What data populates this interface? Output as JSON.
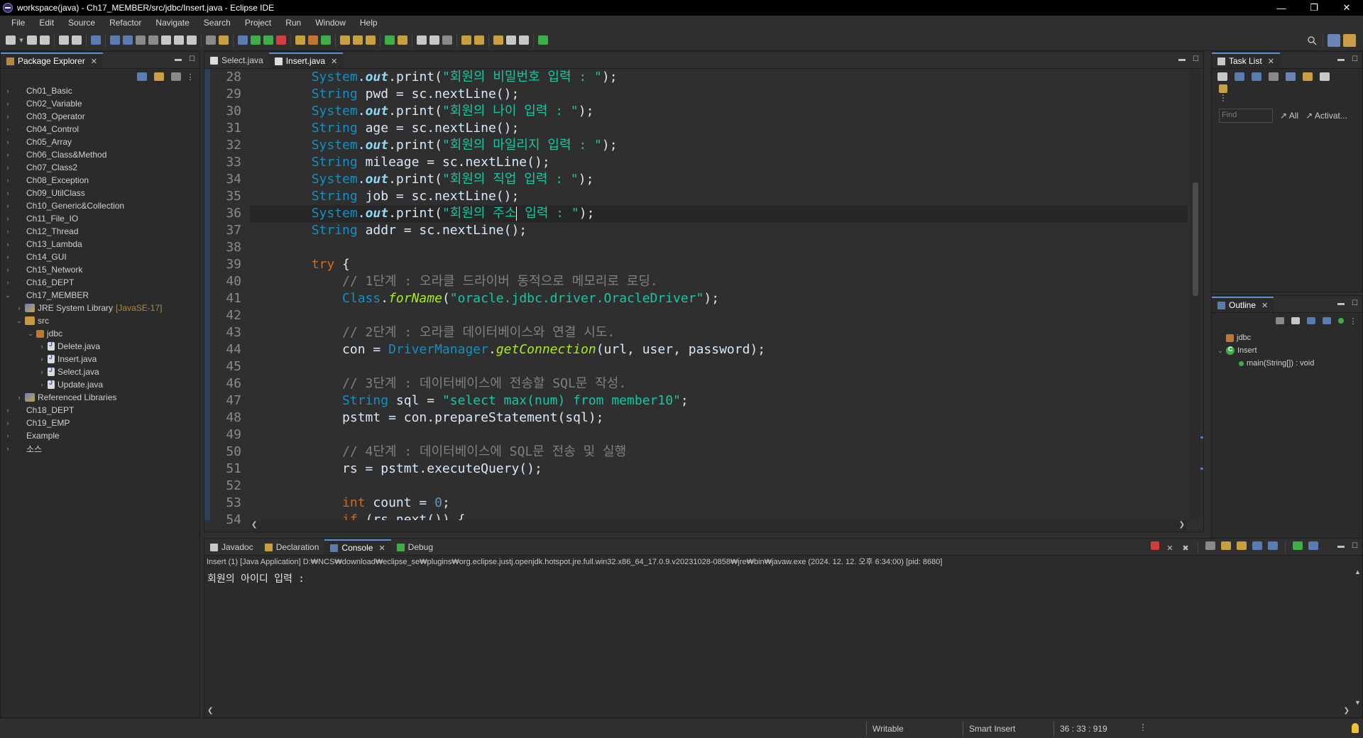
{
  "window": {
    "title": "workspace(java) - Ch17_MEMBER/src/jdbc/Insert.java - Eclipse IDE",
    "min_glyph": "—",
    "restore_glyph": "❐",
    "close_glyph": "✕"
  },
  "menu": [
    "File",
    "Edit",
    "Source",
    "Refactor",
    "Navigate",
    "Search",
    "Project",
    "Run",
    "Window",
    "Help"
  ],
  "package_explorer": {
    "tab_label": "Package Explorer",
    "items": [
      {
        "label": "Ch01_Basic",
        "indent": 0,
        "type": "project",
        "twisty": "›"
      },
      {
        "label": "Ch02_Variable",
        "indent": 0,
        "type": "project",
        "twisty": "›"
      },
      {
        "label": "Ch03_Operator",
        "indent": 0,
        "type": "project",
        "twisty": "›"
      },
      {
        "label": "Ch04_Control",
        "indent": 0,
        "type": "project",
        "twisty": "›"
      },
      {
        "label": "Ch05_Array",
        "indent": 0,
        "type": "project",
        "twisty": "›"
      },
      {
        "label": "Ch06_Class&Method",
        "indent": 0,
        "type": "project",
        "twisty": "›"
      },
      {
        "label": "Ch07_Class2",
        "indent": 0,
        "type": "project",
        "twisty": "›"
      },
      {
        "label": "Ch08_Exception",
        "indent": 0,
        "type": "project",
        "twisty": "›"
      },
      {
        "label": "Ch09_UtilClass",
        "indent": 0,
        "type": "project",
        "twisty": "›"
      },
      {
        "label": "Ch10_Generic&Collection",
        "indent": 0,
        "type": "project",
        "twisty": "›"
      },
      {
        "label": "Ch11_File_IO",
        "indent": 0,
        "type": "project",
        "twisty": "›"
      },
      {
        "label": "Ch12_Thread",
        "indent": 0,
        "type": "project",
        "twisty": "›"
      },
      {
        "label": "Ch13_Lambda",
        "indent": 0,
        "type": "project",
        "twisty": "›"
      },
      {
        "label": "Ch14_GUI",
        "indent": 0,
        "type": "project",
        "twisty": "›"
      },
      {
        "label": "Ch15_Network",
        "indent": 0,
        "type": "project",
        "twisty": "›"
      },
      {
        "label": "Ch16_DEPT",
        "indent": 0,
        "type": "project",
        "twisty": "›"
      },
      {
        "label": "Ch17_MEMBER",
        "indent": 0,
        "type": "project",
        "twisty": "⌄"
      },
      {
        "label": "JRE System Library",
        "indent": 1,
        "type": "lib",
        "twisty": "›",
        "decoration": "[JavaSE-17]"
      },
      {
        "label": "src",
        "indent": 1,
        "type": "src",
        "twisty": "⌄"
      },
      {
        "label": "jdbc",
        "indent": 2,
        "type": "pkg",
        "twisty": "⌄"
      },
      {
        "label": "Delete.java",
        "indent": 3,
        "type": "java",
        "twisty": "›"
      },
      {
        "label": "Insert.java",
        "indent": 3,
        "type": "java",
        "twisty": "›"
      },
      {
        "label": "Select.java",
        "indent": 3,
        "type": "java",
        "twisty": "›"
      },
      {
        "label": "Update.java",
        "indent": 3,
        "type": "java",
        "twisty": "›"
      },
      {
        "label": "Referenced Libraries",
        "indent": 1,
        "type": "lib",
        "twisty": "›"
      },
      {
        "label": "Ch18_DEPT",
        "indent": 0,
        "type": "project",
        "twisty": "›"
      },
      {
        "label": "Ch19_EMP",
        "indent": 0,
        "type": "project",
        "twisty": "›"
      },
      {
        "label": "Example",
        "indent": 0,
        "type": "project",
        "twisty": "›"
      },
      {
        "label": "소스",
        "indent": 0,
        "type": "project",
        "twisty": "›"
      }
    ]
  },
  "editor": {
    "tabs": [
      {
        "label": "Select.java",
        "active": false
      },
      {
        "label": "Insert.java",
        "active": true
      }
    ],
    "current_line": 36,
    "lines": [
      {
        "n": "28",
        "tokens": [
          [
            "plain",
            "        "
          ],
          [
            "cls",
            "System"
          ],
          [
            "plain",
            "."
          ],
          [
            "fld",
            "out"
          ],
          [
            "plain",
            "."
          ],
          [
            "plain",
            "print"
          ],
          [
            "plain",
            "("
          ],
          [
            "st",
            "\"회원의 비밀번호 입력 : \""
          ],
          [
            "plain",
            ");"
          ]
        ]
      },
      {
        "n": "29",
        "tokens": [
          [
            "plain",
            "        "
          ],
          [
            "cls",
            "String"
          ],
          [
            "plain",
            " pwd = sc.nextLine();"
          ]
        ]
      },
      {
        "n": "30",
        "tokens": [
          [
            "plain",
            "        "
          ],
          [
            "cls",
            "System"
          ],
          [
            "plain",
            "."
          ],
          [
            "fld",
            "out"
          ],
          [
            "plain",
            ".print("
          ],
          [
            "st",
            "\"회원의 나이 입력 : \""
          ],
          [
            "plain",
            ");"
          ]
        ]
      },
      {
        "n": "31",
        "tokens": [
          [
            "plain",
            "        "
          ],
          [
            "cls",
            "String"
          ],
          [
            "plain",
            " age = sc.nextLine();"
          ]
        ]
      },
      {
        "n": "32",
        "tokens": [
          [
            "plain",
            "        "
          ],
          [
            "cls",
            "System"
          ],
          [
            "plain",
            "."
          ],
          [
            "fld",
            "out"
          ],
          [
            "plain",
            ".print("
          ],
          [
            "st",
            "\"회원의 마일리지 입력 : \""
          ],
          [
            "plain",
            ");"
          ]
        ]
      },
      {
        "n": "33",
        "tokens": [
          [
            "plain",
            "        "
          ],
          [
            "cls",
            "String"
          ],
          [
            "plain",
            " mileage = sc.nextLine();"
          ]
        ]
      },
      {
        "n": "34",
        "tokens": [
          [
            "plain",
            "        "
          ],
          [
            "cls",
            "System"
          ],
          [
            "plain",
            "."
          ],
          [
            "fld",
            "out"
          ],
          [
            "plain",
            ".print("
          ],
          [
            "st",
            "\"회원의 직업 입력 : \""
          ],
          [
            "plain",
            ");"
          ]
        ]
      },
      {
        "n": "35",
        "tokens": [
          [
            "plain",
            "        "
          ],
          [
            "cls",
            "String"
          ],
          [
            "plain",
            " job = sc.nextLine();"
          ]
        ]
      },
      {
        "n": "36",
        "tokens": [
          [
            "plain",
            "        "
          ],
          [
            "cls",
            "System"
          ],
          [
            "plain",
            "."
          ],
          [
            "fld",
            "out"
          ],
          [
            "plain",
            ".print("
          ],
          [
            "st",
            "\"회원의 주소"
          ],
          [
            "caret",
            ""
          ],
          [
            "st",
            " 입력 : \""
          ],
          [
            "plain",
            ");"
          ]
        ]
      },
      {
        "n": "37",
        "tokens": [
          [
            "plain",
            "        "
          ],
          [
            "cls",
            "String"
          ],
          [
            "plain",
            " addr = sc.nextLine();"
          ]
        ]
      },
      {
        "n": "38",
        "tokens": []
      },
      {
        "n": "39",
        "tokens": [
          [
            "plain",
            "        "
          ],
          [
            "kw",
            "try"
          ],
          [
            "plain",
            " {"
          ]
        ]
      },
      {
        "n": "40",
        "tokens": [
          [
            "plain",
            "            "
          ],
          [
            "cm",
            "// 1단계 : 오라클 드라이버 동적으로 메모리로 로딩."
          ]
        ]
      },
      {
        "n": "41",
        "tokens": [
          [
            "plain",
            "            "
          ],
          [
            "cls",
            "Class"
          ],
          [
            "plain",
            "."
          ],
          [
            "mth",
            "forName"
          ],
          [
            "plain",
            "("
          ],
          [
            "st",
            "\"oracle.jdbc.driver.OracleDriver\""
          ],
          [
            "plain",
            ");"
          ]
        ]
      },
      {
        "n": "42",
        "tokens": []
      },
      {
        "n": "43",
        "tokens": [
          [
            "plain",
            "            "
          ],
          [
            "cm",
            "// 2단계 : 오라클 데이터베이스와 연결 시도."
          ]
        ]
      },
      {
        "n": "44",
        "tokens": [
          [
            "plain",
            "            con = "
          ],
          [
            "cls",
            "DriverManager"
          ],
          [
            "plain",
            "."
          ],
          [
            "mth",
            "getConnection"
          ],
          [
            "plain",
            "(url, user, password);"
          ]
        ]
      },
      {
        "n": "45",
        "tokens": []
      },
      {
        "n": "46",
        "tokens": [
          [
            "plain",
            "            "
          ],
          [
            "cm",
            "// 3단계 : 데이터베이스에 전송할 SQL문 작성."
          ]
        ]
      },
      {
        "n": "47",
        "tokens": [
          [
            "plain",
            "            "
          ],
          [
            "cls",
            "String"
          ],
          [
            "plain",
            " sql = "
          ],
          [
            "st",
            "\"select max(num) from member10\""
          ],
          [
            "plain",
            ";"
          ]
        ]
      },
      {
        "n": "48",
        "tokens": [
          [
            "plain",
            "            pstmt = con.prepareStatement(sql);"
          ]
        ]
      },
      {
        "n": "49",
        "tokens": []
      },
      {
        "n": "50",
        "tokens": [
          [
            "plain",
            "            "
          ],
          [
            "cm",
            "// 4단계 : 데이터베이스에 SQL문 전송 및 실행"
          ]
        ]
      },
      {
        "n": "51",
        "tokens": [
          [
            "plain",
            "            rs = pstmt.executeQuery();"
          ]
        ]
      },
      {
        "n": "52",
        "tokens": []
      },
      {
        "n": "53",
        "tokens": [
          [
            "plain",
            "            "
          ],
          [
            "kw",
            "int"
          ],
          [
            "plain",
            " count = "
          ],
          [
            "num",
            "0"
          ],
          [
            "plain",
            ";"
          ]
        ]
      },
      {
        "n": "54",
        "tokens": [
          [
            "plain",
            "            "
          ],
          [
            "kw",
            "if"
          ],
          [
            "plain",
            " (rs.next()) {"
          ]
        ]
      }
    ]
  },
  "bottom": {
    "tabs": [
      {
        "label": "Javadoc",
        "active": false
      },
      {
        "label": "Declaration",
        "active": false
      },
      {
        "label": "Console",
        "active": true
      },
      {
        "label": "Debug",
        "active": false
      }
    ],
    "console_info": "Insert (1) [Java Application] D:₩NCS₩download₩eclipse_se₩plugins₩org.eclipse.justj.openjdk.hotspot.jre.full.win32.x86_64_17.0.9.v20231028-0858₩jre₩bin₩javaw.exe  (2024. 12. 12. 오후 6:34:00) [pid: 8680]",
    "console_output": "회원의 아이디 입력 :"
  },
  "task_list": {
    "tab_label": "Task List",
    "find_placeholder": "Find",
    "all_label": "All",
    "activate_label": "Activat..."
  },
  "outline": {
    "tab_label": "Outline",
    "items": [
      {
        "label": "jdbc",
        "indent": 0,
        "type": "pkg",
        "twisty": ""
      },
      {
        "label": "Insert",
        "indent": 0,
        "type": "class",
        "twisty": "⌄"
      },
      {
        "label": "main(String[]) : void",
        "indent": 1,
        "type": "method",
        "twisty": ""
      }
    ]
  },
  "status": {
    "writable": "Writable",
    "insert_mode": "Smart Insert",
    "position": "36 : 33 : 919"
  },
  "colors": {
    "keyword": "#cc6c1d",
    "class": "#1290c3",
    "string": "#17c6a3",
    "comment": "#808080",
    "accent": "#5b8fd6"
  }
}
